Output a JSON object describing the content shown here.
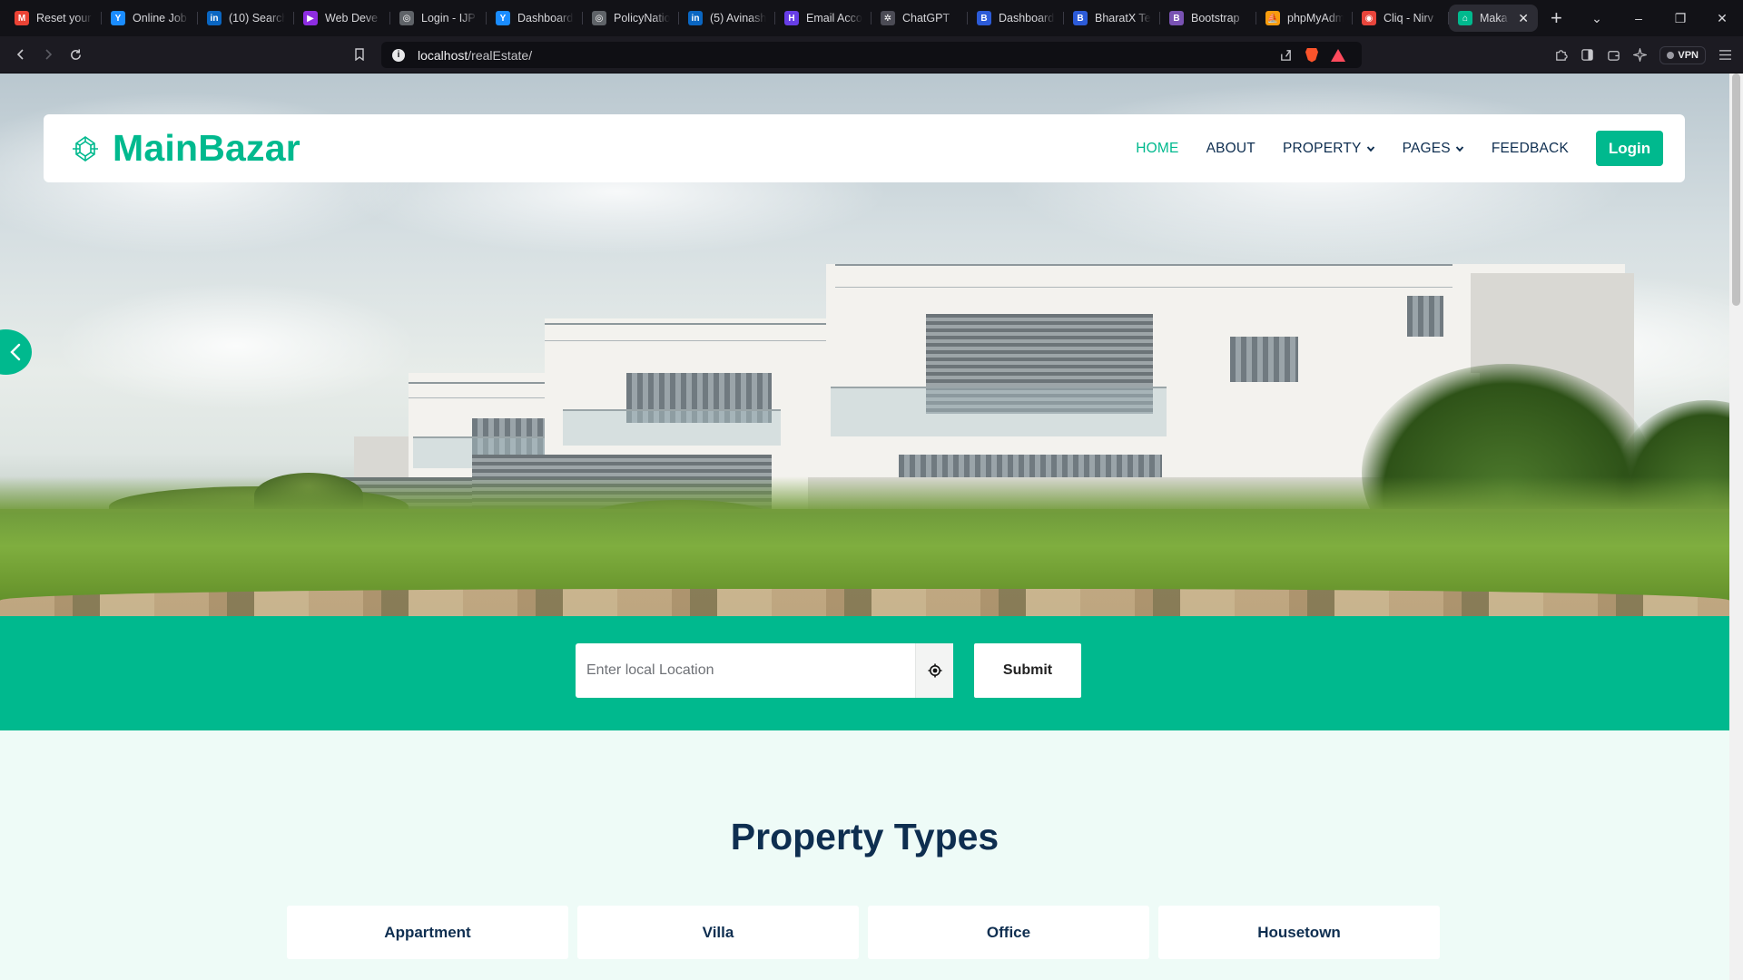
{
  "browser": {
    "tabs": [
      {
        "label": "Reset your",
        "icon": "gmail-icon",
        "color": "#ea4335",
        "glyph": "M"
      },
      {
        "label": "Online Job",
        "icon": "y-logo-icon",
        "color": "#1a8cff",
        "glyph": "Y"
      },
      {
        "label": "(10) Search",
        "icon": "linkedin-icon",
        "color": "#0a66c2",
        "glyph": "in"
      },
      {
        "label": "Web Deve",
        "icon": "play-arrow-icon",
        "color": "#8e2de2",
        "glyph": "▶"
      },
      {
        "label": "Login - IJP",
        "icon": "globe-icon",
        "color": "#5f6368",
        "glyph": "◎"
      },
      {
        "label": "Dashboard",
        "icon": "y-logo-icon",
        "color": "#1a8cff",
        "glyph": "Y"
      },
      {
        "label": "PolicyNatio",
        "icon": "globe-icon",
        "color": "#5f6368",
        "glyph": "◎"
      },
      {
        "label": "(5) Avinash",
        "icon": "linkedin-icon",
        "color": "#0a66c2",
        "glyph": "in"
      },
      {
        "label": "Email Acco",
        "icon": "h-logo-icon",
        "color": "#673de6",
        "glyph": "H"
      },
      {
        "label": "ChatGPT",
        "icon": "openai-icon",
        "color": "#4b4b55",
        "glyph": "✲"
      },
      {
        "label": "Dashboard",
        "icon": "b-logo-icon",
        "color": "#2c5bd8",
        "glyph": "B"
      },
      {
        "label": "BharatX Te",
        "icon": "b-logo-icon",
        "color": "#2c5bd8",
        "glyph": "B"
      },
      {
        "label": "Bootstrap",
        "icon": "bootstrap-icon",
        "color": "#7952b3",
        "glyph": "B"
      },
      {
        "label": "phpMyAdm",
        "icon": "phpmyadmin-icon",
        "color": "#f89c0e",
        "glyph": "⛵"
      },
      {
        "label": "Cliq - Nirv",
        "icon": "cliq-icon",
        "color": "#e8453c",
        "glyph": "◉"
      },
      {
        "label": "Maka",
        "icon": "home-icon",
        "color": "#00b98e",
        "glyph": "⌂",
        "active": true
      }
    ],
    "url_host": "localhost",
    "url_path": "/realEstate/",
    "vpn_label": "VPN"
  },
  "site": {
    "brand": "MainBazar",
    "nav": [
      {
        "label": "HOME",
        "active": true
      },
      {
        "label": "ABOUT"
      },
      {
        "label": "PROPERTY",
        "dropdown": true
      },
      {
        "label": "PAGES",
        "dropdown": true
      },
      {
        "label": "FEEDBACK"
      }
    ],
    "login_label": "Login"
  },
  "search": {
    "placeholder": "Enter local Location",
    "submit_label": "Submit"
  },
  "property_types": {
    "title": "Property Types",
    "items": [
      "Appartment",
      "Villa",
      "Office",
      "Housetown"
    ]
  },
  "colors": {
    "accent": "#00b98e",
    "navy": "#0e2e50"
  }
}
